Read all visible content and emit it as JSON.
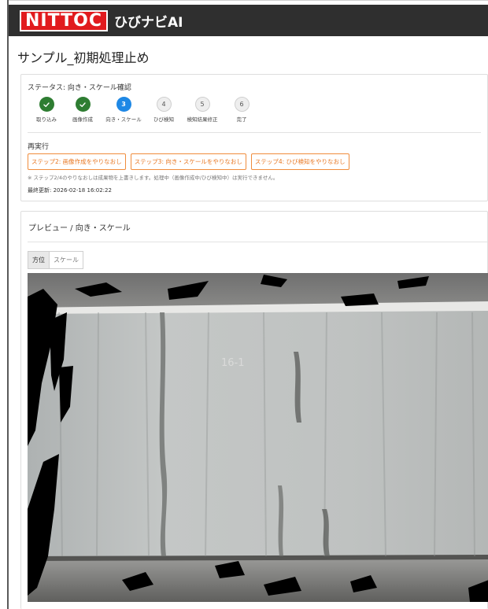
{
  "header": {
    "logo_text": "NITTOC",
    "app_name": "ひびナビAI",
    "colors": {
      "bar": "#2f2f2f",
      "logo": "#e11b1e"
    }
  },
  "page": {
    "title": "サンプル_初期処理止め"
  },
  "status": {
    "text": "ステータス: 向き・スケール確認",
    "steps": [
      {
        "number": "1",
        "label": "取り込み",
        "state": "done",
        "icon": "check-icon"
      },
      {
        "number": "2",
        "label": "画像作成",
        "state": "done",
        "icon": "check-icon"
      },
      {
        "number": "3",
        "label": "向き・スケール",
        "state": "current"
      },
      {
        "number": "4",
        "label": "ひび検知",
        "state": "todo"
      },
      {
        "number": "5",
        "label": "検知結果修正",
        "state": "todo"
      },
      {
        "number": "6",
        "label": "完了",
        "state": "todo"
      }
    ],
    "state_colors": {
      "done": "#2e7d32",
      "current": "#1e88e5",
      "todo": "#eeeeee"
    }
  },
  "rerun": {
    "title": "再実行",
    "buttons": [
      "ステップ2: 画像作成をやりなおし",
      "ステップ3: 向き・スケールをやりなおし",
      "ステップ4: ひび検知をやりなおし"
    ],
    "button_color": "#e87722",
    "note": "※ ステップ2/4のやりなおしは成果物を上書きします。処理中（画像作成中/ひび検知中）は実行できません。",
    "last_updated": "最終更新: 2026-02-18 16:02:22"
  },
  "preview": {
    "title": "プレビュー / 向き・スケール",
    "tabs": [
      {
        "label": "方位",
        "active": true
      },
      {
        "label": "スケール",
        "active": false
      }
    ],
    "image_alt": "concrete wall preview"
  }
}
